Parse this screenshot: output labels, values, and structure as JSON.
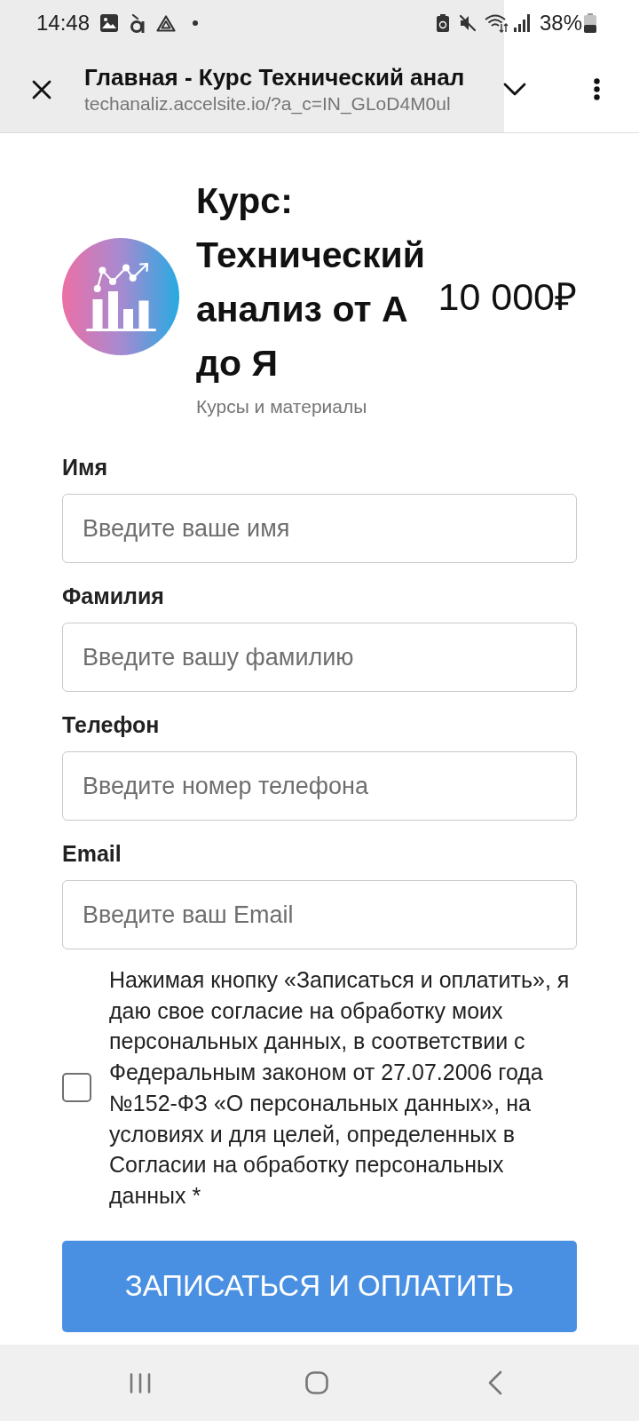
{
  "status_bar": {
    "time": "14:48",
    "battery": "38%"
  },
  "browser_bar": {
    "title": "Главная - Курс Технический анал",
    "url": "techanaliz.accelsite.io/?a_c=IN_GLoD4M0ul"
  },
  "product": {
    "title": "Курс: Технический анализ от А до Я",
    "price": "10 000₽",
    "category": "Курсы и материалы"
  },
  "form": {
    "fields": [
      {
        "label": "Имя",
        "placeholder": "Введите ваше имя"
      },
      {
        "label": "Фамилия",
        "placeholder": "Введите вашу фамилию"
      },
      {
        "label": "Телефон",
        "placeholder": "Введите номер телефона"
      },
      {
        "label": "Email",
        "placeholder": "Введите ваш Email"
      }
    ],
    "consent": {
      "checked": false,
      "text": "Нажимая кнопку «Записаться и оплатить», я даю свое согласие на обработку моих персональных данных, в соответствии с Федеральным законом от 27.07.2006 года №152-ФЗ «О персональных данных», на условиях и для целей, определенных в Согласии на обработку персональных данных *"
    },
    "submit_button": "ЗАПИСАТЬСЯ И ОПЛАТИТЬ"
  }
}
